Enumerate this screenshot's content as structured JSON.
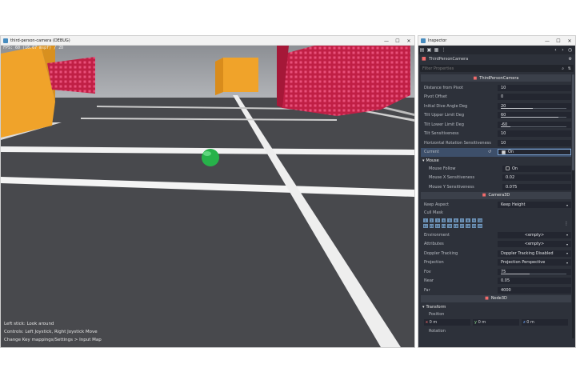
{
  "game": {
    "title": "third-person-camera (DEBUG)",
    "fps": "FPS: 60 (16.67 mspf) / 2D",
    "hints": [
      "Left stick: Look around",
      "Controls: Left Joystick, Right Joystick Move",
      "Change Key mappings/Settings > Input Map"
    ]
  },
  "inspector": {
    "title": "Inspector",
    "object_name": "ThirdPersonCamera",
    "filter_placeholder": "Filter Properties",
    "section_tpc": "ThirdPersonCamera",
    "props": {
      "distance_label": "Distance from Pivot",
      "distance_value": "10",
      "pivot_label": "Pivot Offset",
      "pivot_value": "0",
      "initial_dive_label": "Initial Dive Angle Deg",
      "initial_dive_value": "20",
      "tilt_upper_label": "Tilt Upper Limit Deg",
      "tilt_upper_value": "60",
      "tilt_lower_label": "Tilt Lower Limit Deg",
      "tilt_lower_value": "-60",
      "tilt_sens_label": "Tilt Sensitiveness",
      "tilt_sens_value": "10",
      "horiz_sens_label": "Horizontal Rotation Sensitiveness",
      "horiz_sens_value": "10",
      "current_label": "Current",
      "current_value": "On"
    },
    "mouse_group": "Mouse",
    "mouse": {
      "follow_label": "Mouse Follow",
      "follow_value": "On",
      "x_sens_label": "Mouse X Sensitiveness",
      "x_sens_value": "0.02",
      "y_sens_label": "Mouse Y Sensitiveness",
      "y_sens_value": "0.075"
    },
    "section_cam": "Camera3D",
    "cam": {
      "keep_aspect_label": "Keep Aspect",
      "keep_aspect_value": "Keep Height",
      "cull_mask_label": "Cull Mask",
      "layers": [
        "1",
        "2",
        "3",
        "4",
        "5",
        "6",
        "7",
        "8",
        "9",
        "10",
        "11",
        "12",
        "13",
        "14",
        "15",
        "16",
        "17",
        "18",
        "19",
        "20"
      ],
      "environment_label": "Environment",
      "environment_value": "<empty>",
      "attributes_label": "Attributes",
      "attributes_value": "<empty>",
      "doppler_label": "Doppler Tracking",
      "doppler_value": "Doppler Tracking Disabled",
      "projection_label": "Projection",
      "projection_value": "Projection Perspective",
      "fov_label": "Fov",
      "fov_value": "75",
      "near_label": "Near",
      "near_value": "0.05",
      "far_label": "Far",
      "far_value": "4000"
    },
    "section_node3d": "Node3D",
    "transform_group": "Transform",
    "transform": {
      "position_label": "Position",
      "pos_x": "0 m",
      "pos_y": "0 m",
      "pos_z": "0 m",
      "rotation_label": "Rotation"
    }
  },
  "colors": {
    "accent": "#478cbf",
    "selection": "#3d4f6a",
    "orange_box": "#f0a32a",
    "red_box": "#c8214a",
    "green_ball": "#27b24a"
  }
}
